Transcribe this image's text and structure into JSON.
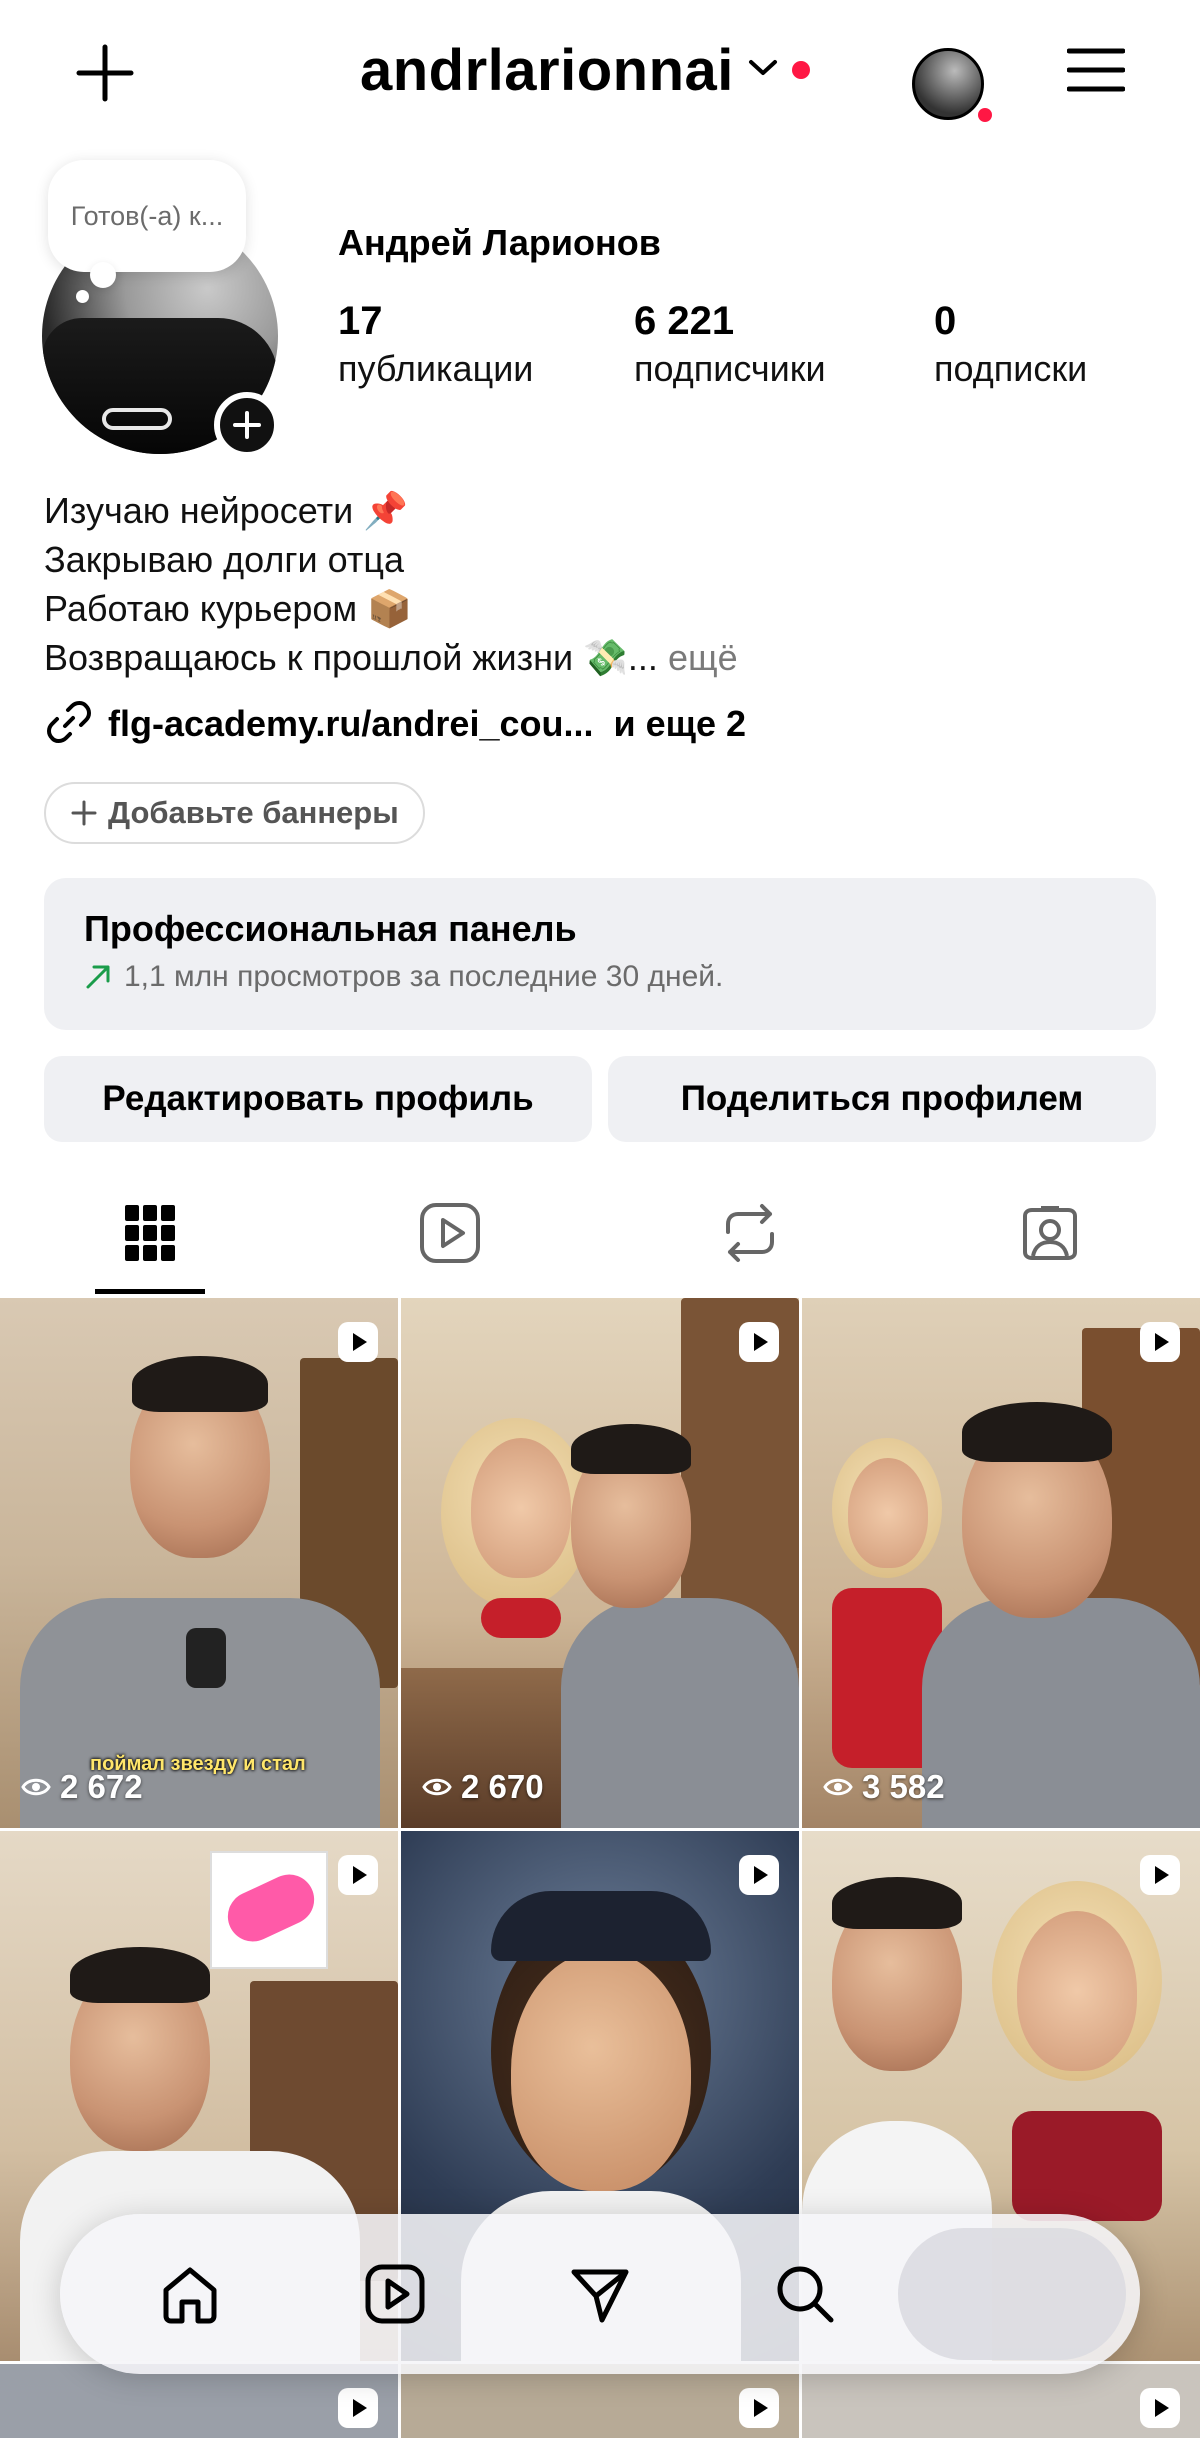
{
  "header": {
    "username": "andrlarionnai",
    "add_icon": "plus-icon",
    "dropdown_icon": "chevron-down-icon",
    "threads_icon": "threads-icon",
    "menu_icon": "hamburger-menu-icon",
    "notification_color": "#ff1744"
  },
  "profile": {
    "note": "Готов(-а) к...",
    "display_name": "Андрей Ларионов",
    "stats": [
      {
        "value": "17",
        "label": "публикации"
      },
      {
        "value": "6 221",
        "label": "подписчики"
      },
      {
        "value": "0",
        "label": "подписки"
      }
    ],
    "bio_lines": [
      "Изучаю нейросети 📌",
      "Закрываю долги отца",
      "Работаю курьером 📦",
      "Возвращаюсь к прошлой жизни 💸..."
    ],
    "bio_more": "ещё",
    "link_text": "flg-academy.ru/andrei_cou...",
    "link_more": "и еще 2",
    "banner_button": "Добавьте баннеры"
  },
  "pro_panel": {
    "title": "Профессиональная панель",
    "subtitle": "1,1 млн просмотров за последние 30 дней.",
    "accent": "#1a9c4a"
  },
  "actions": {
    "edit": "Редактировать профиль",
    "share": "Поделиться профилем"
  },
  "tabs": [
    "grid-icon",
    "reels-icon",
    "reposts-icon",
    "tagged-icon"
  ],
  "posts": [
    {
      "views": "2 672",
      "caption": "поймал звезду и стал"
    },
    {
      "views": "2 670"
    },
    {
      "views": "3 582"
    },
    {
      "views": ""
    },
    {
      "views": ""
    },
    {
      "views": ""
    }
  ],
  "nav": [
    "home-icon",
    "reels-icon",
    "direct-icon",
    "search-icon",
    "profile-avatar"
  ]
}
